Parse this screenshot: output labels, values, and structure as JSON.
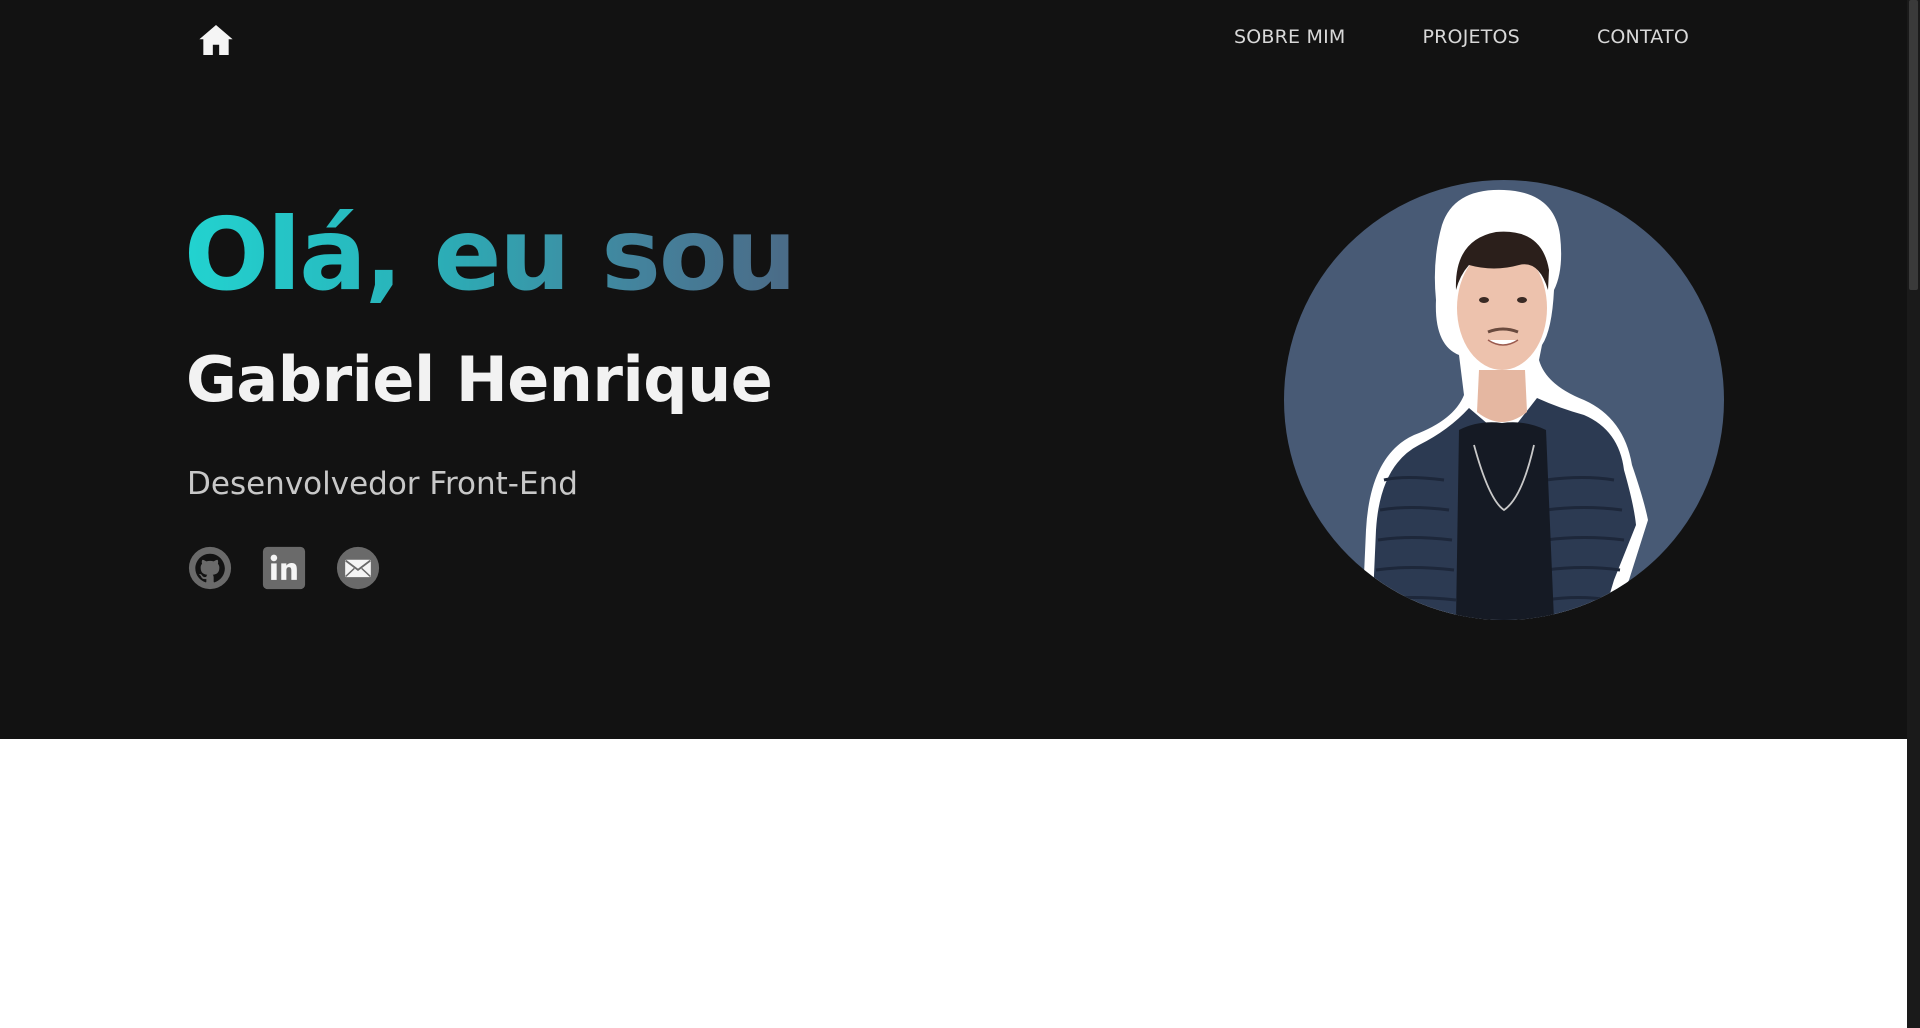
{
  "nav": {
    "home_icon": "home-icon",
    "links": [
      {
        "label": "SOBRE MIM"
      },
      {
        "label": "PROJETOS"
      },
      {
        "label": "CONTATO"
      }
    ]
  },
  "hero": {
    "greeting": "Olá, eu sou",
    "name": "Gabriel Henrique",
    "role": "Desenvolvedor Front-End",
    "socials": [
      {
        "icon": "github-icon"
      },
      {
        "icon": "linkedin-icon"
      },
      {
        "icon": "mail-icon"
      }
    ],
    "avatar_icon": "profile-photo"
  },
  "colors": {
    "background": "#121212",
    "gradient_start": "#22d3d0",
    "gradient_end": "#4b6a86",
    "avatar_bg": "#485a75",
    "text": "#f2f2f2"
  }
}
